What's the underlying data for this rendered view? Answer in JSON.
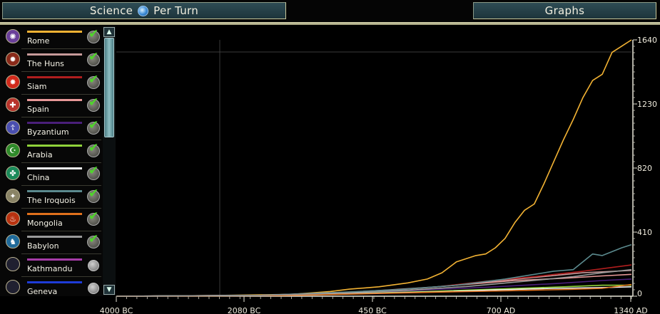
{
  "header": {
    "left_title_a": "Science",
    "left_title_b": "Per Turn",
    "right_title": "Graphs"
  },
  "legend": {
    "items": [
      {
        "name": "Rome",
        "color": "#f2b233",
        "emblem_color": "#6a3f9a",
        "glyph": "✺",
        "checked": true
      },
      {
        "name": "The Huns",
        "color": "#c79a9a",
        "emblem_color": "#8a2a1a",
        "glyph": "✹",
        "checked": true
      },
      {
        "name": "Siam",
        "color": "#b01e1e",
        "emblem_color": "#d12a1c",
        "glyph": "✸",
        "checked": true
      },
      {
        "name": "Spain",
        "color": "#e89898",
        "emblem_color": "#b8332b",
        "glyph": "✚",
        "checked": true
      },
      {
        "name": "Byzantium",
        "color": "#4a1f7a",
        "emblem_color": "#4a4fb0",
        "glyph": "☦",
        "checked": true
      },
      {
        "name": "Arabia",
        "color": "#8fd23a",
        "emblem_color": "#2f8a2a",
        "glyph": "☪",
        "checked": true
      },
      {
        "name": "China",
        "color": "#f4f4f4",
        "emblem_color": "#1b8a5a",
        "glyph": "✤",
        "checked": true
      },
      {
        "name": "The Iroquois",
        "color": "#5b8a8e",
        "emblem_color": "#8a8466",
        "glyph": "✦",
        "checked": true
      },
      {
        "name": "Mongolia",
        "color": "#e0701c",
        "emblem_color": "#b83210",
        "glyph": "♨",
        "checked": true
      },
      {
        "name": "Babylon",
        "color": "#9a9a9a",
        "emblem_color": "#1f6a9a",
        "glyph": "♞",
        "checked": true
      },
      {
        "name": "Kathmandu",
        "color": "#a63ca8",
        "emblem_color": "#202030",
        "glyph": "",
        "checked": false
      },
      {
        "name": "Geneva",
        "color": "#1e3cd8",
        "emblem_color": "#202030",
        "glyph": "",
        "checked": false
      }
    ]
  },
  "chart_data": {
    "type": "line",
    "title": "",
    "xlabel": "",
    "ylabel": "",
    "x_ticks": [
      "4000 BC",
      "2080 BC",
      "450 BC",
      "700 AD",
      "1340 AD"
    ],
    "y_ticks": [
      0,
      410,
      820,
      1230,
      1640
    ],
    "ylim": [
      0,
      1640
    ],
    "turns": 96,
    "series": [
      {
        "name": "Rome",
        "color": "#f2b233",
        "points": [
          [
            0,
            0
          ],
          [
            20,
            4
          ],
          [
            36,
            12
          ],
          [
            44,
            30
          ],
          [
            48,
            45
          ],
          [
            54,
            60
          ],
          [
            60,
            85
          ],
          [
            64,
            110
          ],
          [
            67,
            150
          ],
          [
            70,
            220
          ],
          [
            74,
            260
          ],
          [
            76,
            270
          ],
          [
            78,
            310
          ],
          [
            80,
            370
          ],
          [
            82,
            470
          ],
          [
            84,
            550
          ],
          [
            86,
            590
          ],
          [
            88,
            720
          ],
          [
            90,
            860
          ],
          [
            92,
            1000
          ],
          [
            94,
            1130
          ],
          [
            96,
            1270
          ],
          [
            98,
            1380
          ],
          [
            100,
            1420
          ],
          [
            102,
            1560
          ],
          [
            104,
            1600
          ],
          [
            106,
            1640
          ]
        ]
      },
      {
        "name": "The Huns",
        "color": "#c79a9a",
        "points": [
          [
            0,
            0
          ],
          [
            30,
            6
          ],
          [
            46,
            22
          ],
          [
            56,
            40
          ],
          [
            66,
            60
          ],
          [
            76,
            90
          ],
          [
            86,
            120
          ],
          [
            96,
            150
          ],
          [
            106,
            165
          ]
        ]
      },
      {
        "name": "Siam",
        "color": "#b01e1e",
        "points": [
          [
            0,
            0
          ],
          [
            30,
            5
          ],
          [
            46,
            20
          ],
          [
            56,
            36
          ],
          [
            66,
            60
          ],
          [
            76,
            95
          ],
          [
            86,
            125
          ],
          [
            96,
            160
          ],
          [
            106,
            200
          ]
        ]
      },
      {
        "name": "Spain",
        "color": "#e89898",
        "points": [
          [
            0,
            0
          ],
          [
            30,
            6
          ],
          [
            50,
            28
          ],
          [
            62,
            50
          ],
          [
            72,
            75
          ],
          [
            82,
            100
          ],
          [
            92,
            115
          ],
          [
            100,
            130
          ],
          [
            106,
            140
          ]
        ]
      },
      {
        "name": "Byzantium",
        "color": "#4a1f7a",
        "points": [
          [
            0,
            0
          ],
          [
            32,
            4
          ],
          [
            50,
            20
          ],
          [
            64,
            40
          ],
          [
            78,
            60
          ],
          [
            90,
            80
          ],
          [
            100,
            100
          ],
          [
            106,
            110
          ]
        ]
      },
      {
        "name": "Arabia",
        "color": "#8fd23a",
        "points": [
          [
            0,
            0
          ],
          [
            34,
            5
          ],
          [
            50,
            18
          ],
          [
            64,
            30
          ],
          [
            78,
            45
          ],
          [
            92,
            60
          ],
          [
            100,
            70
          ],
          [
            106,
            70
          ]
        ]
      },
      {
        "name": "China",
        "color": "#f4f4f4",
        "points": [
          [
            0,
            0
          ],
          [
            34,
            5
          ],
          [
            52,
            18
          ],
          [
            66,
            28
          ],
          [
            78,
            40
          ],
          [
            90,
            50
          ],
          [
            100,
            55
          ],
          [
            106,
            60
          ]
        ]
      },
      {
        "name": "The Iroquois",
        "color": "#5b8a8e",
        "points": [
          [
            0,
            0
          ],
          [
            30,
            6
          ],
          [
            46,
            25
          ],
          [
            58,
            42
          ],
          [
            70,
            70
          ],
          [
            80,
            110
          ],
          [
            86,
            140
          ],
          [
            90,
            160
          ],
          [
            94,
            170
          ],
          [
            98,
            270
          ],
          [
            100,
            260
          ],
          [
            104,
            310
          ],
          [
            106,
            330
          ]
        ]
      },
      {
        "name": "Mongolia",
        "color": "#e0701c",
        "points": [
          [
            0,
            0
          ],
          [
            34,
            4
          ],
          [
            52,
            16
          ],
          [
            66,
            26
          ],
          [
            80,
            34
          ],
          [
            94,
            44
          ],
          [
            100,
            50
          ],
          [
            106,
            75
          ]
        ]
      },
      {
        "name": "Babylon",
        "color": "#9a9a9a",
        "points": [
          [
            0,
            0
          ],
          [
            30,
            5
          ],
          [
            48,
            22
          ],
          [
            60,
            38
          ],
          [
            72,
            62
          ],
          [
            84,
            95
          ],
          [
            94,
            125
          ],
          [
            100,
            150
          ],
          [
            106,
            170
          ]
        ]
      }
    ]
  }
}
